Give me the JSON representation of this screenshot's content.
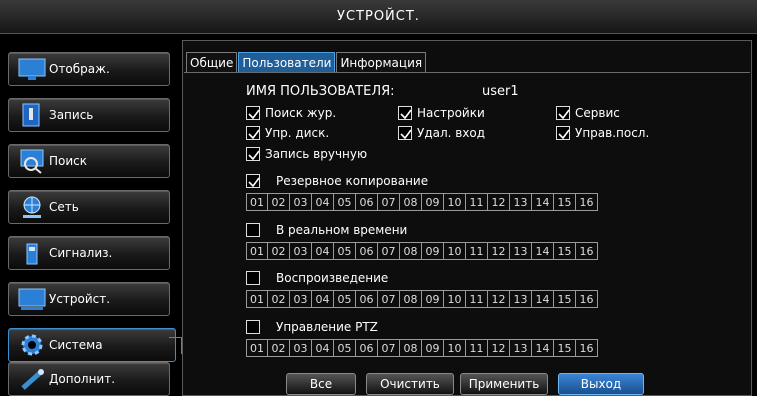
{
  "window": {
    "title": "УСТРОЙСТ."
  },
  "sidebar": {
    "items": [
      {
        "label": "Отображ.",
        "icon": "monitor-icon",
        "active": false
      },
      {
        "label": "Запись",
        "icon": "record-icon",
        "active": false
      },
      {
        "label": "Поиск",
        "icon": "search-icon",
        "active": false
      },
      {
        "label": "Сеть",
        "icon": "network-icon",
        "active": false
      },
      {
        "label": "Сигнализ.",
        "icon": "alarm-icon",
        "active": false
      },
      {
        "label": "Устройст.",
        "icon": "device-icon",
        "active": false
      },
      {
        "label": "Система",
        "icon": "gear-icon",
        "active": true
      },
      {
        "label": "Дополнит.",
        "icon": "advanced-icon",
        "active": false
      }
    ]
  },
  "tabs": [
    {
      "label": "Общие",
      "active": false
    },
    {
      "label": "Пользователи",
      "active": true
    },
    {
      "label": "Информация",
      "active": false
    }
  ],
  "user": {
    "label": "ИМЯ ПОЛЬЗОВАТЕЛЯ:",
    "value": "user1"
  },
  "permissions": {
    "log_search": {
      "label": "Поиск жур.",
      "checked": true
    },
    "settings": {
      "label": "Настройки",
      "checked": true
    },
    "service": {
      "label": "Сервис",
      "checked": true
    },
    "disk_mgmt": {
      "label": "Упр. диск.",
      "checked": true
    },
    "remote_login": {
      "label": "Удал. вход",
      "checked": true
    },
    "seq_control": {
      "label": "Управ.посл.",
      "checked": true
    },
    "manual_record": {
      "label": "Запись вручную",
      "checked": true
    }
  },
  "channel_groups": [
    {
      "label": "Резервное копирование",
      "checked": true
    },
    {
      "label": "В реальном времени",
      "checked": false
    },
    {
      "label": "Воспроизведение",
      "checked": false
    },
    {
      "label": "Управление PTZ",
      "checked": false
    }
  ],
  "channels": [
    "01",
    "02",
    "03",
    "04",
    "05",
    "06",
    "07",
    "08",
    "09",
    "10",
    "11",
    "12",
    "13",
    "14",
    "15",
    "16"
  ],
  "buttons": {
    "all": "Все",
    "clear": "Очистить",
    "apply": "Применить",
    "exit": "Выход"
  },
  "colors": {
    "accent": "#1f5e99",
    "highlight": "#3b8fd0"
  }
}
